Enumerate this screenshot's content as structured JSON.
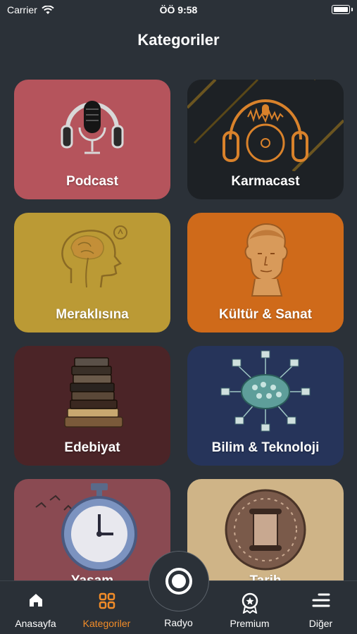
{
  "status": {
    "carrier": "Carrier",
    "time": "ÖÖ 9:58"
  },
  "header": {
    "title": "Kategoriler"
  },
  "categories": [
    {
      "label": "Podcast",
      "color": "#b5545c",
      "icon": "headphones-microphone-icon"
    },
    {
      "label": "Karmacast",
      "color": "#1d2125",
      "icon": "headphones-disc-icon"
    },
    {
      "label": "Meraklısına",
      "color": "#bb9a35",
      "icon": "brain-head-icon"
    },
    {
      "label": "Kültür & Sanat",
      "color": "#cf6a1a",
      "icon": "statue-bust-icon"
    },
    {
      "label": "Edebiyat",
      "color": "#4b2427",
      "icon": "book-stack-icon"
    },
    {
      "label": "Bilim & Teknoloji",
      "color": "#26345a",
      "icon": "brain-network-icon"
    },
    {
      "label": "Yaşam",
      "color": "#8a4a52",
      "icon": "stopwatch-icon"
    },
    {
      "label": "Tarih",
      "color": "#cfb487",
      "icon": "scroll-seal-icon"
    }
  ],
  "tabbar": {
    "items": [
      {
        "label": "Anasayfa",
        "icon": "home-icon"
      },
      {
        "label": "Kategoriler",
        "icon": "grid-icon"
      },
      {
        "label": "Radyo",
        "icon": "record-icon"
      },
      {
        "label": "Premium",
        "icon": "premium-badge-icon"
      },
      {
        "label": "Diğer",
        "icon": "menu-icon"
      }
    ],
    "active_color": "#f28c28"
  }
}
